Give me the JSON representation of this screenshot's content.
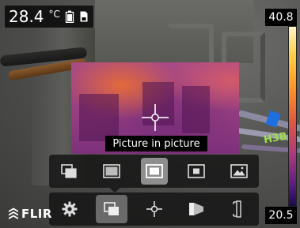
{
  "measurement": {
    "temperature_value": "28.4",
    "temperature_unit": "°C"
  },
  "status_icons": [
    "battery-icon",
    "memory-card-icon"
  ],
  "scale": {
    "max": "40.8",
    "min": "20.5",
    "palette_colors": [
      "#fff6c8",
      "#ffd04a",
      "#ff9b2a",
      "#e35a3c",
      "#a83880",
      "#5a1f80",
      "#1a0a4c"
    ]
  },
  "tooltip": {
    "text": "Picture in picture"
  },
  "image_mode_menu": {
    "items": [
      {
        "icon": "thermal-msx-icon",
        "selected": false
      },
      {
        "icon": "thermal-icon",
        "selected": false
      },
      {
        "icon": "picture-in-picture-icon",
        "selected": true
      },
      {
        "icon": "thermal-fusion-icon",
        "selected": false
      },
      {
        "icon": "digital-camera-icon",
        "selected": false
      }
    ]
  },
  "main_toolbar": {
    "items": [
      {
        "icon": "settings-gear-icon",
        "selected": false
      },
      {
        "icon": "image-mode-icon",
        "selected": true
      },
      {
        "icon": "measurement-spot-icon",
        "selected": false
      },
      {
        "icon": "color-palette-icon",
        "selected": false
      },
      {
        "icon": "temperature-scale-icon",
        "selected": false
      }
    ]
  },
  "scene_labels": {
    "cable_tag": "H3B"
  },
  "brand": {
    "logo_text": "FLIR",
    "accent": "#8e8e8e"
  }
}
